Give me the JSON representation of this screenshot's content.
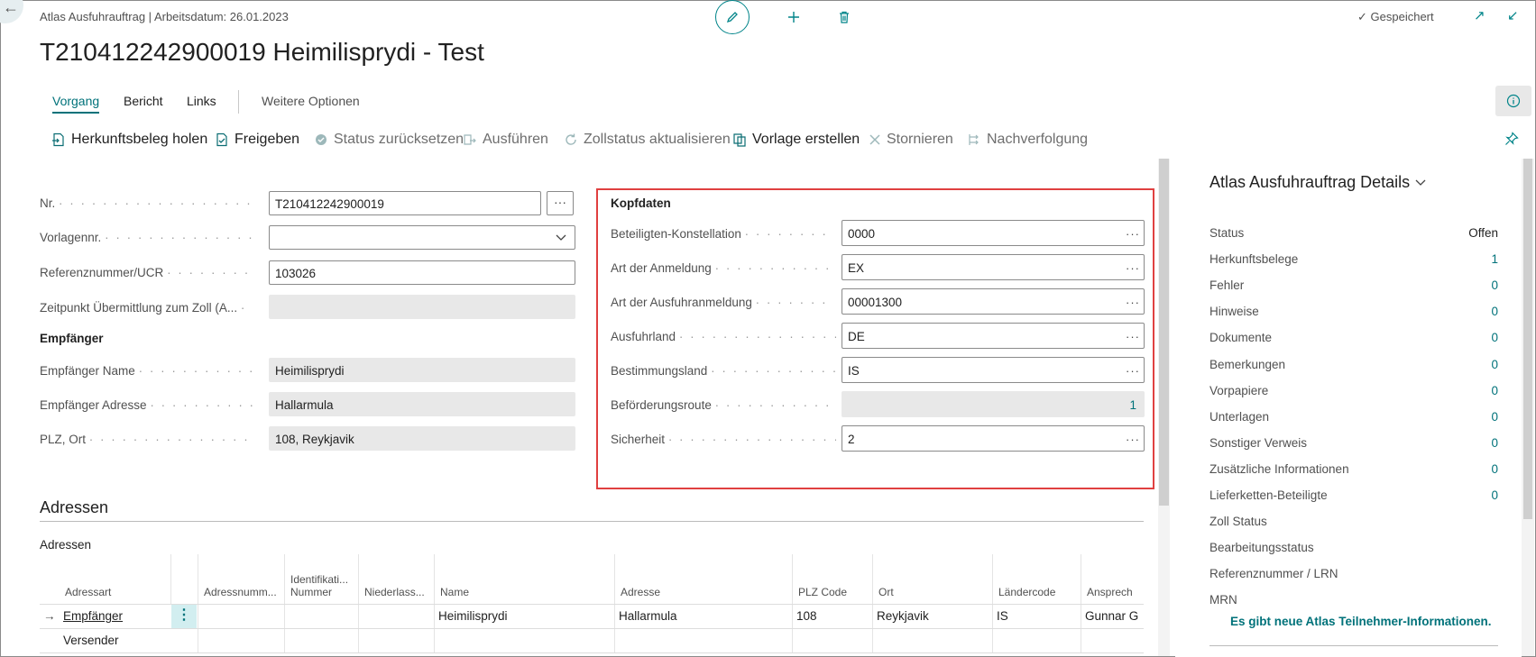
{
  "header": {
    "breadcrumb": "Atlas Ausfuhrauftrag | Arbeitsdatum: 26.01.2023",
    "title": "T210412242900019 Heimilisprydi - Test",
    "saved_label": "Gespeichert"
  },
  "tabs": [
    "Vorgang",
    "Bericht",
    "Links",
    "Weitere Optionen"
  ],
  "actions": [
    "Herkunftsbeleg holen",
    "Freigeben",
    "Status zurücksetzen",
    "Ausführen",
    "Zollstatus aktualisieren",
    "Vorlage erstellen",
    "Stornieren",
    "Nachverfolgung"
  ],
  "general": {
    "nr_label": "Nr.",
    "nr_value": "T210412242900019",
    "vorlage_label": "Vorlagennr.",
    "vorlage_value": "",
    "ref_label": "Referenznummer/UCR",
    "ref_value": "103026",
    "zeit_label": "Zeitpunkt Übermittlung zum Zoll (A...",
    "zeit_value": ""
  },
  "empfaenger": {
    "section": "Empfänger",
    "name_label": "Empfänger Name",
    "name_value": "Heimilisprydi",
    "addr_label": "Empfänger Adresse",
    "addr_value": "Hallarmula",
    "plz_label": "PLZ, Ort",
    "plz_value": "108,  Reykjavik"
  },
  "kopfdaten": {
    "section": "Kopfdaten",
    "fields": [
      {
        "label": "Beteiligten-Konstellation",
        "value": "0000"
      },
      {
        "label": "Art der Anmeldung",
        "value": "EX"
      },
      {
        "label": "Art der Ausfuhranmeldung",
        "value": "00001300"
      },
      {
        "label": "Ausfuhrland",
        "value": "DE"
      },
      {
        "label": "Bestimmungsland",
        "value": "IS"
      },
      {
        "label": "Beförderungsroute",
        "value": "1"
      },
      {
        "label": "Sicherheit",
        "value": "2"
      }
    ]
  },
  "details": {
    "title": "Atlas Ausfuhrauftrag Details",
    "rows": [
      {
        "label": "Status",
        "value": "Offen"
      },
      {
        "label": "Herkunftsbelege",
        "value": "1"
      },
      {
        "label": "Fehler",
        "value": "0"
      },
      {
        "label": "Hinweise",
        "value": "0"
      },
      {
        "label": "Dokumente",
        "value": "0"
      },
      {
        "label": "Bemerkungen",
        "value": "0"
      },
      {
        "label": "Vorpapiere",
        "value": "0"
      },
      {
        "label": "Unterlagen",
        "value": "0"
      },
      {
        "label": "Sonstiger Verweis",
        "value": "0"
      },
      {
        "label": "Zusätzliche Informationen",
        "value": "0"
      },
      {
        "label": "Lieferketten-Beteiligte",
        "value": "0"
      },
      {
        "label": "Zoll Status",
        "value": ""
      },
      {
        "label": "Bearbeitungsstatus",
        "value": ""
      },
      {
        "label": "Referenznummer / LRN",
        "value": ""
      },
      {
        "label": "MRN",
        "value": ""
      }
    ],
    "link": "Es gibt neue Atlas Teilnehmer-Informationen."
  },
  "adressen": {
    "heading": "Adressen",
    "subheading": "Adressen",
    "columns": [
      "Adressart",
      "Adressnumm...",
      "Identifikati... Nummer",
      "Niederlass...",
      "Name",
      "Adresse",
      "PLZ Code",
      "Ort",
      "Ländercode",
      "Ansprech"
    ],
    "rows": [
      [
        "Empfänger",
        "",
        "",
        "",
        "Heimilisprydi",
        "Hallarmula",
        "108",
        "Reykjavik",
        "IS",
        "Gunnar G"
      ],
      [
        "Versender",
        "",
        "",
        "",
        "",
        "",
        "",
        "",
        "",
        ""
      ]
    ]
  }
}
